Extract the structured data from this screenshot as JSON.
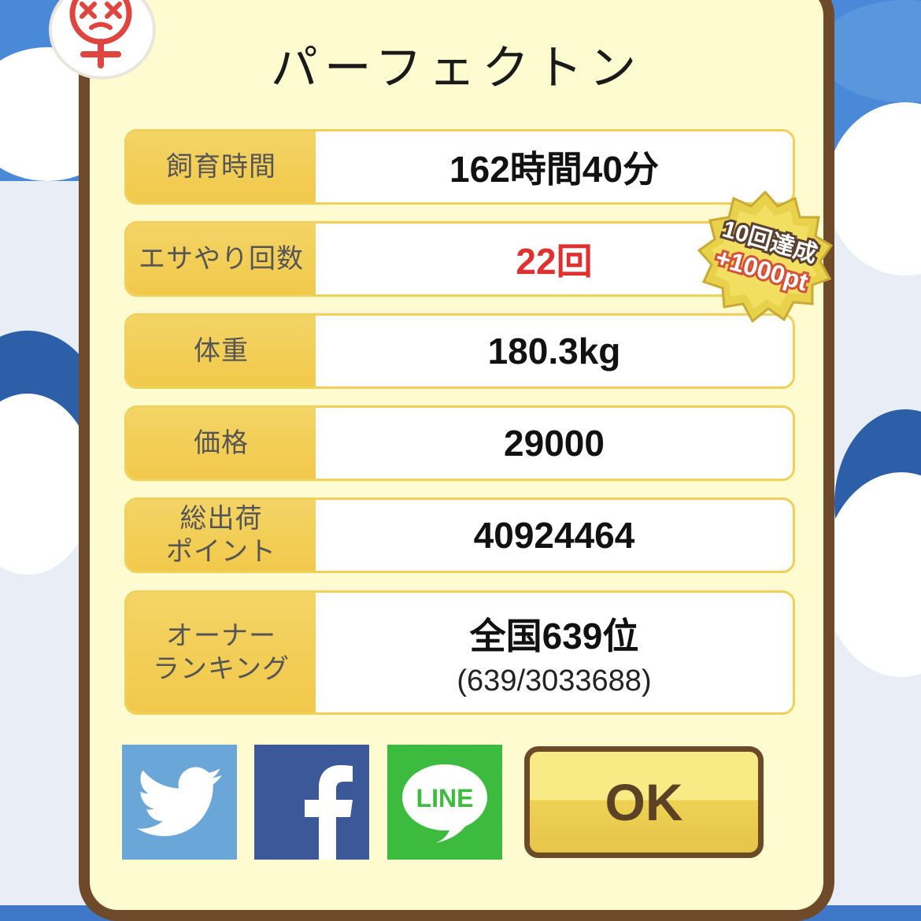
{
  "dialog": {
    "title": "パーフェクトン"
  },
  "stats": [
    {
      "label": "飼育時間",
      "value": "162時間40分"
    },
    {
      "label": "エサやり回数",
      "value": "22回"
    },
    {
      "label": "体重",
      "value": "180.3kg"
    },
    {
      "label": "価格",
      "value": "29000"
    },
    {
      "label_line1": "総出荷",
      "label_line2": "ポイント",
      "value": "40924464"
    },
    {
      "label_line1": "オーナー",
      "label_line2": "ランキング",
      "value": "全国639位",
      "sub": "(639/3033688)"
    }
  ],
  "achievement_seal": {
    "line1": "10回達成",
    "line2": "+1000pt"
  },
  "share": {
    "twitter_icon": "twitter-bird-icon",
    "facebook_icon": "facebook-f-icon",
    "line_icon": "line-bubble-icon",
    "line_text": "LINE"
  },
  "ok_button": {
    "label": "OK"
  },
  "colors": {
    "frame": "#6e4a2a",
    "panel": "#fffbd0",
    "label_bg": "#f2cc50",
    "highlight_value": "#e03030",
    "twitter": "#6aa6d8",
    "facebook": "#3b5898",
    "line": "#3dbb3f"
  }
}
